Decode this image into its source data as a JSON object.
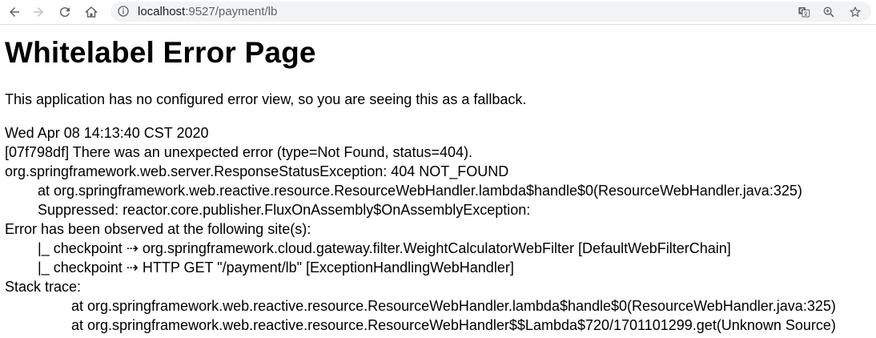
{
  "browser": {
    "url_host": "localhost",
    "url_rest": ":9527/payment/lb",
    "back_icon": "arrow-left-icon",
    "forward_icon": "arrow-right-icon",
    "reload_icon": "reload-icon",
    "home_icon": "home-icon",
    "info_icon": "info-icon",
    "translate_icon": "translate-icon",
    "zoom_icon": "zoom-icon",
    "bookmark_icon": "star-icon"
  },
  "page": {
    "title": "Whitelabel Error Page",
    "intro": "This application has no configured error view, so you are seeing this as a fallback.",
    "lines": [
      "Wed Apr 08 14:13:40 CST 2020",
      "[07f798df] There was an unexpected error (type=Not Found, status=404).",
      "org.springframework.web.server.ResponseStatusException: 404 NOT_FOUND",
      "at org.springframework.web.reactive.resource.ResourceWebHandler.lambda$handle$0(ResourceWebHandler.java:325)",
      "Suppressed: reactor.core.publisher.FluxOnAssembly$OnAssemblyException:",
      "Error has been observed at the following site(s):",
      "|_ checkpoint ⇢ org.springframework.cloud.gateway.filter.WeightCalculatorWebFilter [DefaultWebFilterChain]",
      "|_ checkpoint ⇢ HTTP GET \"/payment/lb\" [ExceptionHandlingWebHandler]",
      "Stack trace:",
      "at org.springframework.web.reactive.resource.ResourceWebHandler.lambda$handle$0(ResourceWebHandler.java:325)",
      "at org.springframework.web.reactive.resource.ResourceWebHandler$$Lambda$720/1701101299.get(Unknown Source)"
    ]
  }
}
